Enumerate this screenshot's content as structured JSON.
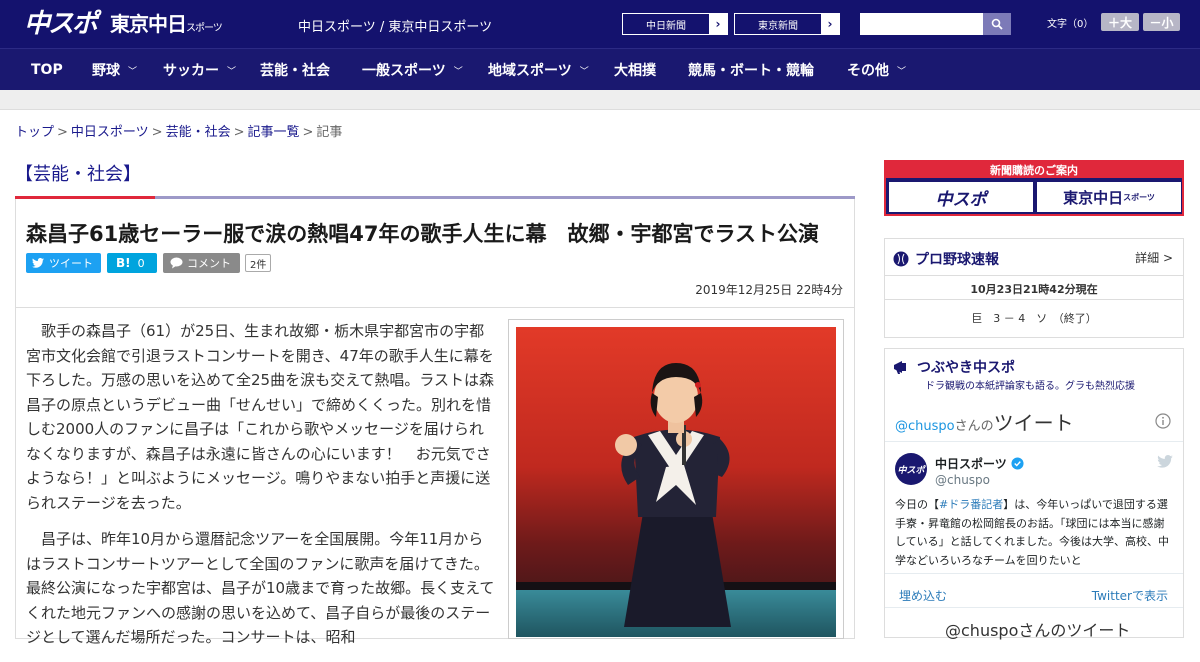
{
  "header": {
    "logo_chunichi": "中スポ",
    "logo_tokyo": "東京中日",
    "logo_tokyo_small": "スポーツ",
    "site_names": "中日スポーツ / 東京中日スポーツ",
    "ext_links": [
      {
        "label": "中日新聞",
        "arrow": "›"
      },
      {
        "label": "東京新聞",
        "arrow": "›"
      }
    ],
    "fontsize_label": "文字（0）",
    "font_larger": "＋大",
    "font_smaller": "－小"
  },
  "nav": {
    "items": [
      {
        "label": "TOP",
        "chev": ""
      },
      {
        "label": "野球",
        "chev": "﹀"
      },
      {
        "label": "サッカー",
        "chev": "﹀"
      },
      {
        "label": "芸能・社会",
        "chev": ""
      },
      {
        "label": "一般スポーツ",
        "chev": "﹀"
      },
      {
        "label": "地域スポーツ",
        "chev": "﹀"
      },
      {
        "label": "大相撲",
        "chev": ""
      },
      {
        "label": "競馬・ボート・競輪",
        "chev": ""
      },
      {
        "label": "その他",
        "chev": "﹀"
      }
    ]
  },
  "breadcrumb": {
    "items": [
      "トップ",
      "中日スポーツ",
      "芸能・社会",
      "記事一覧"
    ],
    "current": "記事",
    "sep": ">"
  },
  "article": {
    "category": "【芸能・社会】",
    "headline": "森昌子61歳セーラー服で涙の熱唱47年の歌手人生に幕　故郷・宇都宮でラスト公演",
    "share": {
      "tweet": "ツイート",
      "hatena": "B!",
      "hatena_count": "0",
      "comment": "コメント",
      "comment_count": "2件"
    },
    "date": "2019年12月25日 22時4分",
    "paragraphs": [
      "歌手の森昌子（61）が25日、生まれ故郷・栃木県宇都宮市の宇都宮市文化会館で引退ラストコンサートを開き、47年の歌手人生に幕を下ろした。万感の思いを込めて全25曲を涙も交えて熱唱。ラストは森昌子の原点というデビュー曲「せんせい」で締めくくった。別れを惜しむ2000人のファンに昌子は「これから歌やメッセージを届けられなくなりますが、森昌子は永遠に皆さんの心にいます！　お元気でさようなら！」と叫ぶようにメッセージ。鳴りやまない拍手と声援に送られステージを去った。",
      "昌子は、昨年10月から還暦記念ツアーを全国展開。今年11月からはラストコンサートツアーとして全国のファンに歌声を届けてきた。最終公演になった宇都宮は、昌子が10歳まで育った故郷。長く支えてくれた地元ファンへの感謝の思いを込めて、昌子自らが最後のステージとして選んだ場所だった。コンサートは、昭和"
    ]
  },
  "sidebar": {
    "subscription": {
      "title": "新聞購読のご案内",
      "logo_left": "中スポ",
      "logo_right": "東京中日",
      "logo_right_small": "スポーツ"
    },
    "baseball": {
      "title": "プロ野球速報",
      "detail": "詳細 >",
      "timestamp": "10月23日21時42分現在",
      "score": "巨　3 － 4　ソ　（終了）"
    },
    "tweets": {
      "title": "つぶやき中スポ",
      "subtitle": "ドラ観戦の本紙評論家も語る。グラも熱烈応援",
      "handle_prefix": "@chuspo",
      "handle_suffix": "さんの",
      "heading": "ツイート",
      "account_name": "中日スポーツ",
      "account_handle": "@chuspo",
      "avatar_text": "中スポ",
      "tweet_prefix": "今日の【",
      "tweet_hashtag": "#ドラ番記者",
      "tweet_body": "】は、今年いっぱいで退団する選手寮・昇竜館の松岡館長のお話。「球団には本当に感謝している」と話してくれました。今後は大学、高校、中学などいろいろなチームを回りたいと",
      "embed": "埋め込む",
      "view_on_twitter": "Twitterで表示",
      "footer": "@chuspoさんのツイート"
    }
  }
}
